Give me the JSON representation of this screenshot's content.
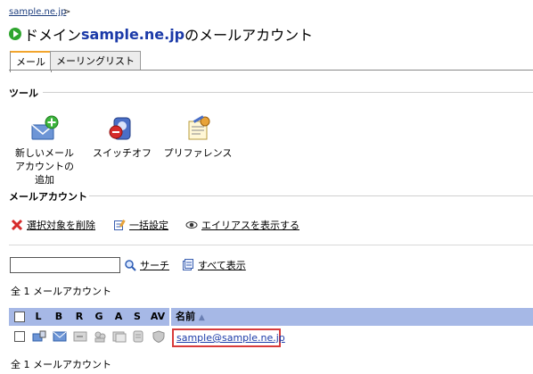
{
  "breadcrumb": {
    "link": "sample.ne.jp",
    "sep": ">"
  },
  "title": {
    "prefix": "ドメイン",
    "domain": "sample.ne.jp",
    "suffix": "のメールアカウント"
  },
  "tabs": [
    {
      "label": "メール",
      "active": true
    },
    {
      "label": "メーリングリスト",
      "active": false
    }
  ],
  "tools": {
    "section_title": "ツール",
    "items": [
      {
        "label": "新しいメールアカウントの追加",
        "icon": "mail-add-icon"
      },
      {
        "label": "スイッチオフ",
        "icon": "switch-off-icon"
      },
      {
        "label": "プリファレンス",
        "icon": "preferences-icon"
      }
    ]
  },
  "accounts": {
    "section_title": "メールアカウント",
    "actions": [
      {
        "label": "選択対象を削除",
        "icon": "delete-icon"
      },
      {
        "label": "一括設定",
        "icon": "group-edit-icon"
      },
      {
        "label": "エイリアスを表示する",
        "icon": "eye-icon"
      }
    ],
    "search": {
      "value": "",
      "placeholder": "",
      "search_label": "サーチ",
      "show_all_label": "すべて表示"
    },
    "count_top": "全 1 メールアカウント",
    "count_bottom": "全 1 メールアカウント",
    "columns": [
      "L",
      "B",
      "R",
      "G",
      "A",
      "S",
      "AV",
      "名前"
    ],
    "sort_indicator": "▲",
    "rows": [
      {
        "name": "sample@sample.ne.jp"
      }
    ]
  },
  "colors": {
    "header_bg": "#a6b8e6",
    "highlight": "#d83b3b",
    "link": "#1b3aa8",
    "tab_accent": "#f2a52d"
  }
}
